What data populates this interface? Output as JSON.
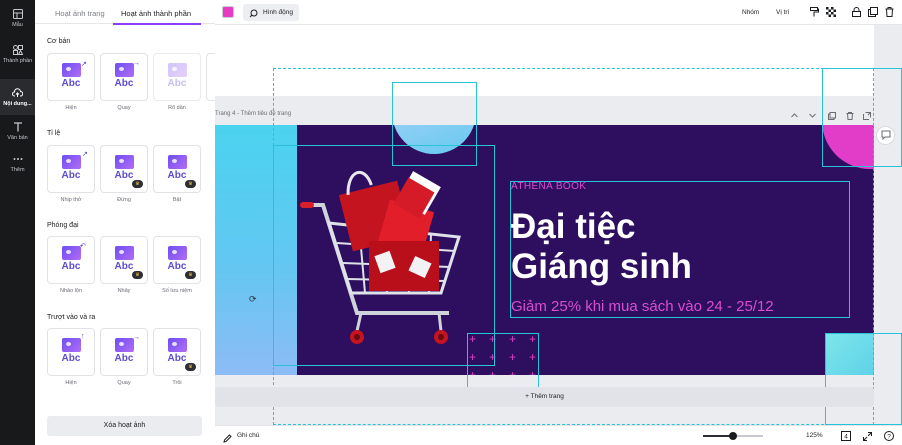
{
  "rail": {
    "items": [
      {
        "label": "Mẫu",
        "icon": "layout-icon"
      },
      {
        "label": "Thành phần",
        "icon": "elements-icon"
      },
      {
        "label": "Nội dung...",
        "icon": "upload-cloud-icon"
      },
      {
        "label": "Văn bản",
        "icon": "text-icon"
      },
      {
        "label": "Thêm",
        "icon": "more-icon"
      }
    ]
  },
  "panel": {
    "tabs": [
      "Hoạt ảnh trang",
      "Hoạt ảnh thành phần"
    ],
    "card_text": "Abc",
    "sections": [
      {
        "title": "Cơ bản",
        "items": [
          "Hiện",
          "Quay",
          "Rõ dần"
        ]
      },
      {
        "title": "Tỉ lệ",
        "items": [
          "Nhịp thở",
          "Đứng",
          "Bật"
        ]
      },
      {
        "title": "Phóng đại",
        "items": [
          "Nhảo lộn",
          "Nhảy",
          "Số lưu niệm"
        ]
      },
      {
        "title": "Trượt vào và ra",
        "items": [
          "Hiện",
          "Quay",
          "Trôi"
        ]
      }
    ],
    "remove_label": "Xóa hoạt ảnh"
  },
  "toolbar": {
    "color": "#e63cc2",
    "animate_label": "Hình động",
    "group_label": "Nhóm",
    "position_label": "Vị trí"
  },
  "canvas": {
    "page_label": "Trang 4 - Thêm tiêu đề trang",
    "brand": "ATHENA BOOK",
    "headline_line1": "Đại tiệc",
    "headline_line2": "Giáng sinh",
    "subline": "Giảm 25% khi mua sách vào 24 - 25/12",
    "add_page_label": "+ Thêm trang",
    "colors": {
      "background": "#2e0e5e",
      "accent_pink": "#e23dc8",
      "accent_cyan": "#4bd3ef"
    }
  },
  "bottombar": {
    "notes_label": "Ghi chú",
    "zoom_label": "125%",
    "zoom_fraction": 0.5,
    "page_count": "4"
  }
}
